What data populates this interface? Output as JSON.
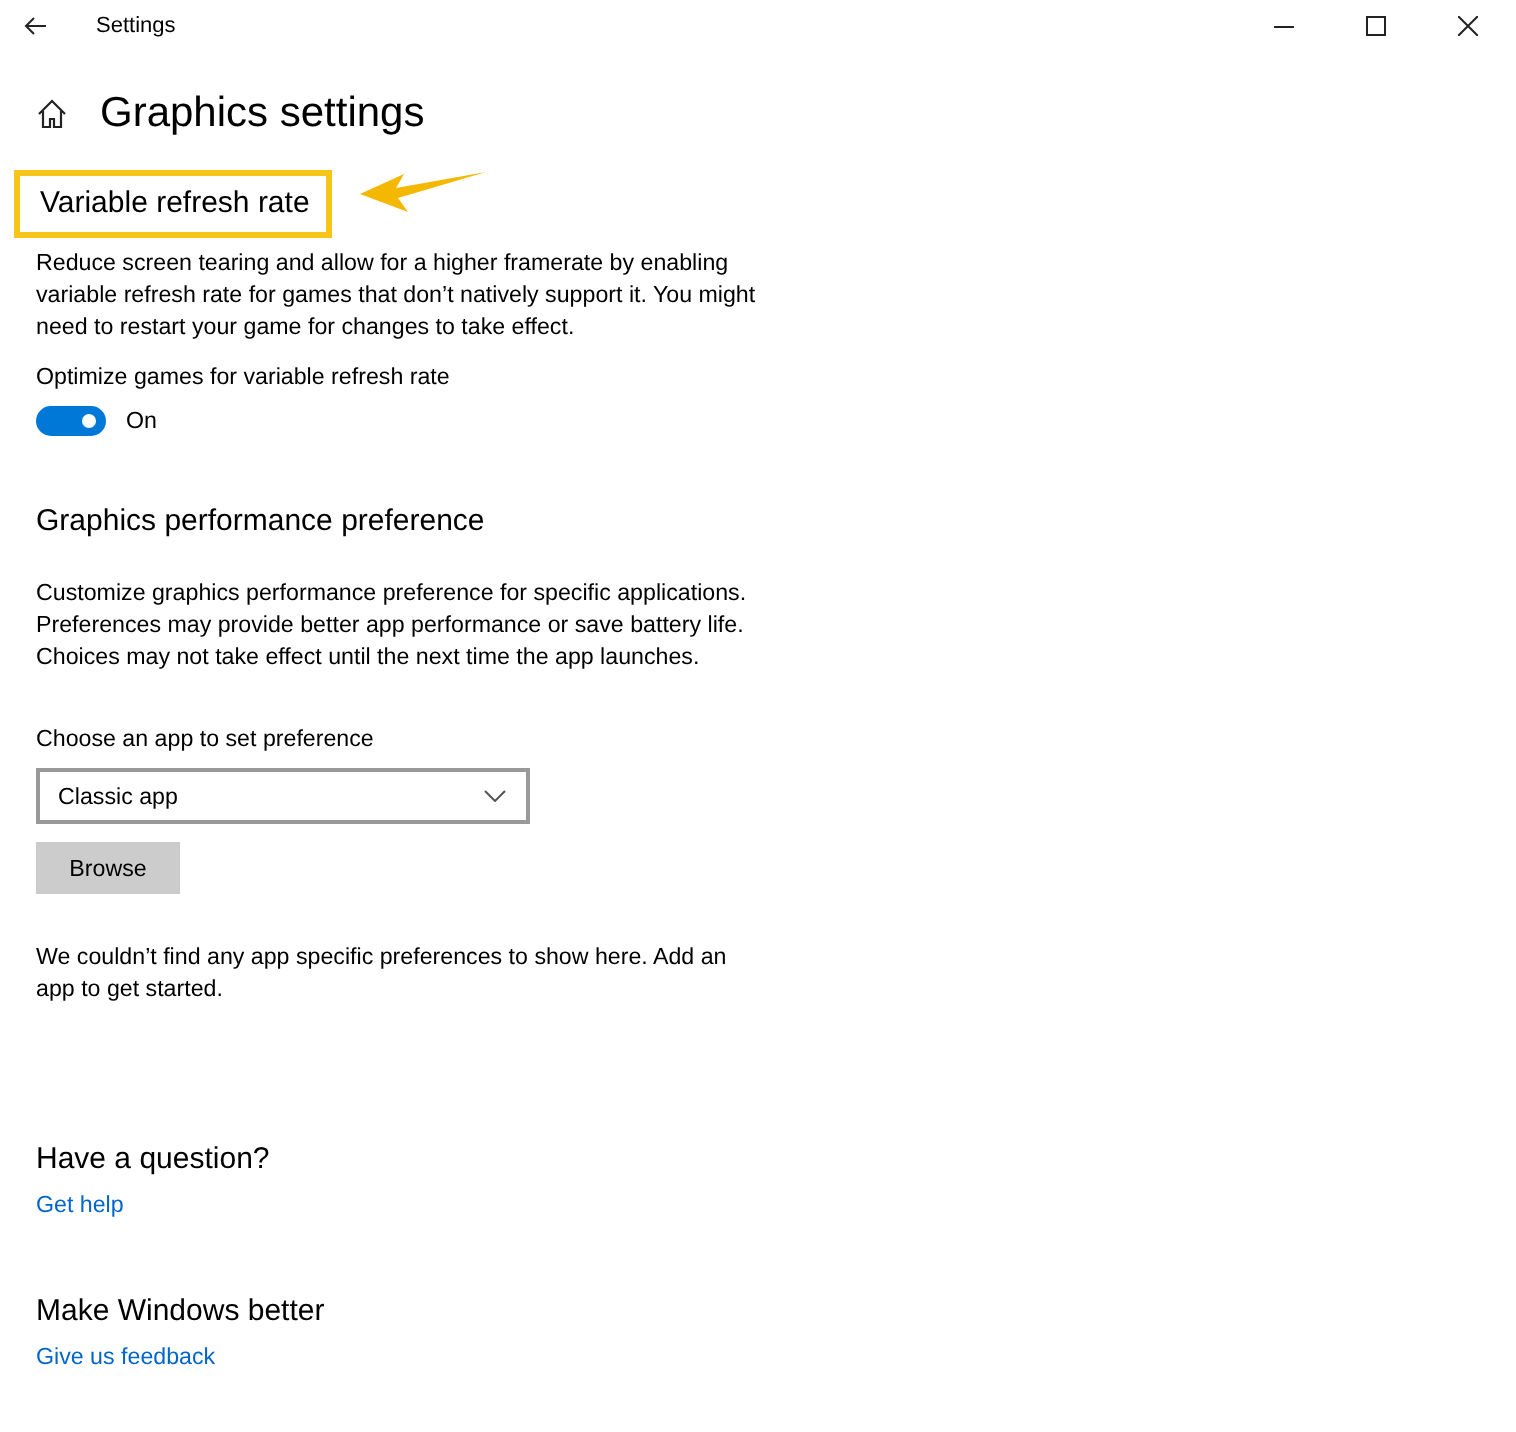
{
  "window": {
    "title": "Settings"
  },
  "page_title": "Graphics settings",
  "vrr": {
    "heading": "Variable refresh rate",
    "highlighted": true,
    "description": "Reduce screen tearing and allow for a higher framerate by enabling variable refresh rate for games that don’t natively support it. You might need to restart your game for changes to take effect.",
    "toggle": {
      "label": "Optimize games for variable refresh rate",
      "on": true,
      "state_text": "On"
    }
  },
  "performance": {
    "heading": "Graphics performance preference",
    "description": "Customize graphics performance preference for specific applications. Preferences may provide better app performance or save battery life. Choices may not take effect until the next time the app launches.",
    "dropdown_label": "Choose an app to set preference",
    "dropdown": {
      "value": "Classic app"
    },
    "button": "Browse",
    "empty_message": "We couldn’t find any app specific preferences to show here. Add an app to get started."
  },
  "help": [
    {
      "heading": "Have a question?",
      "link": "Get help"
    },
    {
      "heading": "Make Windows better",
      "link": "Give us feedback"
    }
  ]
}
